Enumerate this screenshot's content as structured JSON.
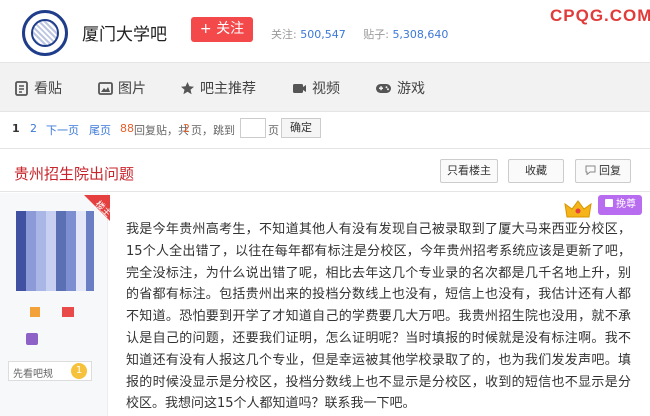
{
  "header": {
    "bar_name": "厦门大学吧",
    "follow_label": "+ 关注",
    "follow_stat_label": "关注:",
    "follow_count": "500,547",
    "post_stat_label": "贴子:",
    "post_count": "5,308,640",
    "watermark": "CPQG.COM"
  },
  "nav": {
    "items": [
      {
        "label": "看贴",
        "icon": "document-icon"
      },
      {
        "label": "图片",
        "icon": "image-icon"
      },
      {
        "label": "吧主推荐",
        "icon": "star-icon"
      },
      {
        "label": "视频",
        "icon": "video-icon"
      },
      {
        "label": "游戏",
        "icon": "gamepad-icon"
      }
    ]
  },
  "pager": {
    "current": "1",
    "page2": "2",
    "next": "下一页",
    "last": "尾页",
    "reply_count": "88",
    "reply_text": "回复贴，共",
    "pages": "2",
    "pages_text": "页，跳到",
    "jump_value": "",
    "page_unit": "页",
    "go_label": "确定"
  },
  "thread": {
    "title": "贵州招生院出问题",
    "btn_only_op": "只看楼主",
    "btn_favorite": "收藏",
    "btn_reply": "回复"
  },
  "post": {
    "badge": "楼主",
    "level_name": "先看吧规",
    "level_num": "1",
    "vip_label": "挽尊",
    "body": "我是今年贵州高考生，不知道其他人有没有发现自己被录取到了厦大马来西亚分校区，15个人全出错了，以往在每年都有标注是分校区，今年贵州招考系统应该是更新了吧，完全没标注，为什么说出错了呢，相比去年这几个专业录的名次都是几千名地上升，别的省都有标注。包括贵州出来的投档分数线上也没有，短信上也没有，我估计还有人都不知道。恐怕要到开学了才知道自己的学费要几大万吧。我贵州招生院也没用，就不承认是自己的问题，还要我们证明，怎么证明呢？当时填报的时候就是没有标注啊。我不知道还有没有人报这几个专业，但是幸运被其他学校录取了的，也为我们发发声吧。填报的时候没显示是分校区，投档分数线上也不显示是分校区，收到的短信也不显示是分校区。我想问这15个人都知道吗？联系我一下吧。"
  }
}
